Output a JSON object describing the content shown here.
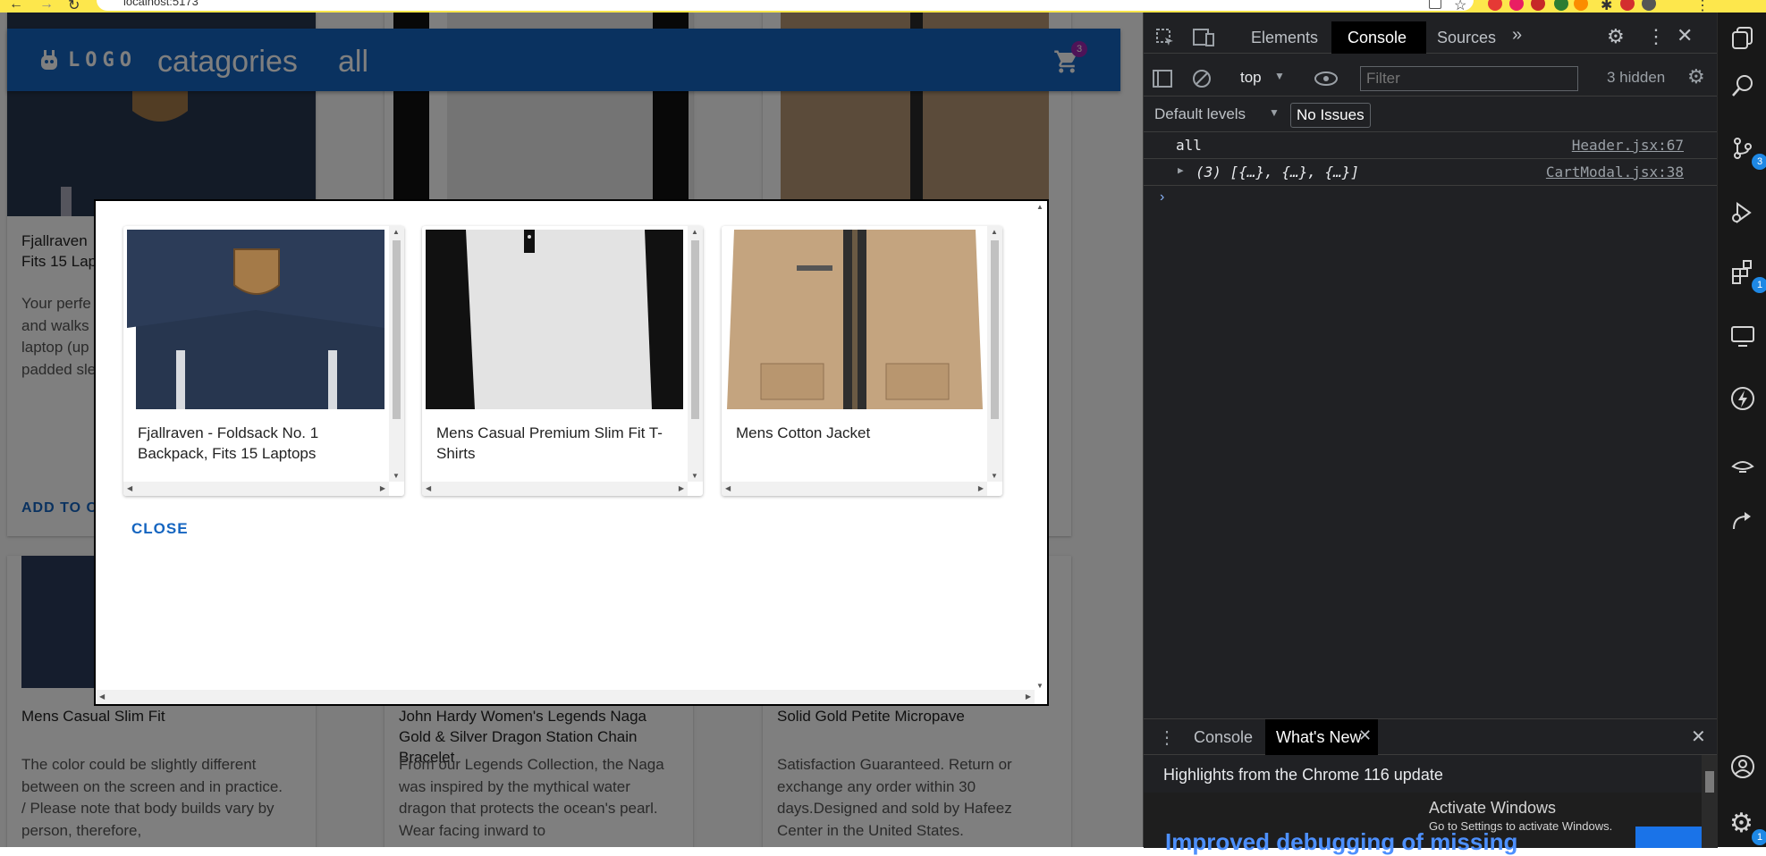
{
  "browser": {
    "url": "localhost:5173"
  },
  "app": {
    "logo": "LOGO",
    "nav": [
      "catagories",
      "all"
    ],
    "cart_count": "3",
    "background_cards": [
      {
        "title": "Fjallraven - Foldsack No. 1 Backpack, Fits 15 Laptops",
        "title_visible": "Fjallraven\nFits 15 Lap",
        "description_visible": "Your perfe\nand walks\nlaptop (up\npadded sle",
        "button": "ADD TO CA"
      },
      {
        "title": "Mens Casual Slim Fit",
        "description": "The color could be slightly different between on the screen and in practice. / Please note that body builds vary by person, therefore,"
      },
      {
        "title": "John Hardy Women's Legends Naga Gold & Silver Dragon Station Chain Bracelet",
        "description": "From our Legends Collection, the Naga was inspired by the mythical water dragon that protects the ocean's pearl. Wear facing inward to"
      },
      {
        "title": "Solid Gold Petite Micropave",
        "description": "Satisfaction Guaranteed. Return or exchange any order within 30 days.Designed and sold by Hafeez Center in the United States."
      }
    ]
  },
  "modal": {
    "items": [
      {
        "title": "Fjallraven - Foldsack No. 1 Backpack, Fits 15 Laptops",
        "image": "backpack"
      },
      {
        "title": "Mens Casual Premium Slim Fit T-Shirts",
        "image": "tshirt"
      },
      {
        "title": "Mens Cotton Jacket",
        "image": "jacket"
      }
    ],
    "close_label": "CLOSE"
  },
  "devtools": {
    "tabs": [
      "Elements",
      "Console",
      "Sources"
    ],
    "active_tab": "Console",
    "context": "top",
    "filter_placeholder": "Filter",
    "hidden_count": "3 hidden",
    "levels": "Default levels",
    "issues": "No Issues",
    "logs": [
      {
        "text": "all",
        "source": "Header.jsx:67"
      },
      {
        "text": "(3) [{…}, {…}, {…}]",
        "source": "CartModal.jsx:38"
      }
    ],
    "drawer": {
      "tabs": [
        "Console",
        "What's New"
      ],
      "active_tab": "What's New",
      "headline": "Highlights from the Chrome 116 update",
      "partial_text": "Improved debugging of missing"
    }
  },
  "sidebar": {
    "badges": [
      "3",
      "1",
      "1"
    ]
  },
  "watermark": {
    "title": "Activate Windows",
    "subtitle": "Go to Settings to activate Windows."
  }
}
